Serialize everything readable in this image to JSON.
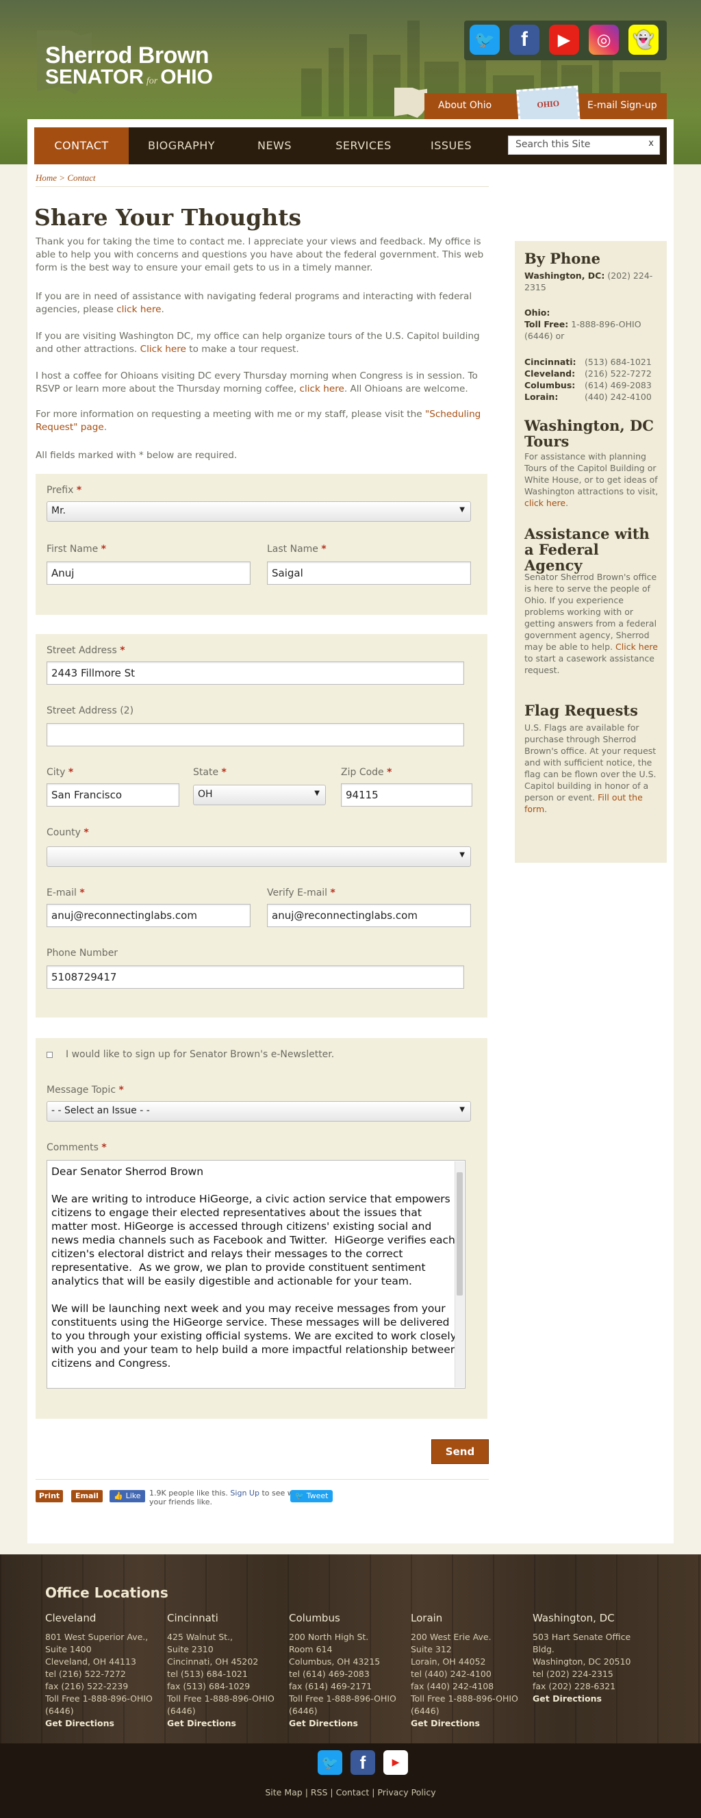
{
  "header": {
    "logo_line1": "Sherrod Brown",
    "logo_senator": "SENATOR",
    "logo_for": "for",
    "logo_ohio": "OHIO",
    "about_link": "About Ohio",
    "signup_link": "E-mail Sign-up",
    "stamp_text": "OHIO"
  },
  "social": {
    "icons": [
      "twitter-icon",
      "facebook-icon",
      "youtube-icon",
      "instagram-icon",
      "snapchat-icon"
    ]
  },
  "nav": {
    "items": [
      "CONTACT",
      "BIOGRAPHY",
      "NEWS",
      "SERVICES",
      "ISSUES"
    ],
    "search_placeholder": "Search this Site",
    "search_clear": "x"
  },
  "breadcrumb": {
    "home": "Home",
    "sep": " > ",
    "current": "Contact"
  },
  "main": {
    "title": "Share Your Thoughts",
    "p1": "Thank you for taking the time to contact me.  I appreciate your views and feedback. My office is able to help you with concerns and questions you have about the federal government. This web form is the best way to ensure your email gets to us in a timely manner.",
    "p2_text": "If you are in need of assistance with navigating federal programs and interacting with federal agencies, please ",
    "p2_link": "click here",
    "p2_end": ".",
    "p3_text": "If you are visiting Washington DC, my office can help organize tours of the U.S. Capitol building and other attractions. ",
    "p3_link": "Click here",
    "p3_end": " to make a tour request.",
    "p4_text": "I host a coffee for Ohioans visiting DC every Thursday morning when Congress is in session. To RSVP or learn more about the Thursday morning coffee, ",
    "p4_link": "click here",
    "p4_end": ". All Ohioans are welcome.",
    "p5_text": "For more information on requesting a meeting with me or my staff, please visit the ",
    "p5_link": "\"Scheduling Request\" page",
    "p5_end": ".",
    "required_note": "All fields marked with * below are required."
  },
  "form": {
    "prefix_label": "Prefix",
    "prefix_value": "Mr.",
    "first_name_label": "First Name",
    "first_name_value": "Anuj",
    "last_name_label": "Last Name",
    "last_name_value": "Saigal",
    "street_label": "Street Address",
    "street_value": "2443 Fillmore St",
    "street2_label": "Street Address (2)",
    "street2_value": "",
    "city_label": "City",
    "city_value": "San Francisco",
    "state_label": "State",
    "state_value": "OH",
    "zip_label": "Zip Code",
    "zip_value": "94115",
    "county_label": "County",
    "county_value": "",
    "email_label": "E-mail",
    "email_value": "anuj@reconnectinglabs.com",
    "verify_email_label": "Verify E-mail",
    "verify_email_value": "anuj@reconnectinglabs.com",
    "phone_label": "Phone Number",
    "phone_value": "5108729417",
    "newsletter_label": "I would like to sign up for Senator Brown's e-Newsletter.",
    "topic_label": "Message Topic",
    "topic_value": "- - Select an Issue - -",
    "comments_label": "Comments",
    "required_mark": "*",
    "comments_value": "Dear Senator Sherrod Brown\n\nWe are writing to introduce HiGeorge, a civic action service that empowers citizens to engage their elected representatives about the issues that matter most. HiGeorge is accessed through citizens' existing social and news media channels such as Facebook and Twitter.  HiGeorge verifies each citizen's electoral district and relays their messages to the correct representative.  As we grow, we plan to provide constituent sentiment analytics that will be easily digestible and actionable for your team.\n\nWe will be launching next week and you may receive messages from your constituents using the HiGeorge service. These messages will be delivered to you through your existing official systems. We are excited to work closely with you and your team to help build a more impactful relationship between citizens and Congress.",
    "send_label": "Send"
  },
  "share": {
    "print": "Print",
    "email": "Email",
    "like": "Like",
    "like_text": "1.9K people like this.",
    "signup": "Sign Up",
    "like_tail": "to see what your friends like.",
    "tweet": "Tweet"
  },
  "sidebar": {
    "phone_title": "By Phone",
    "dc_label": "Washington, DC:",
    "dc_phone": "(202) 224-2315",
    "ohio_label": "Ohio:",
    "tollfree_label": "Toll Free:",
    "tollfree_value": "1-888-896-OHIO (6446) or",
    "cities": [
      {
        "name": "Cincinnati:",
        "phone": "(513) 684-1021"
      },
      {
        "name": "Cleveland:",
        "phone": "(216) 522-7272"
      },
      {
        "name": "Columbus:",
        "phone": "(614) 469-2083"
      },
      {
        "name": "Lorain:",
        "phone": "(440) 242-4100"
      }
    ],
    "tours_title": "Washington, DC Tours",
    "tours_text": "For assistance with planning Tours of the Capitol Building or White House, or to get ideas of Washington attractions to visit, ",
    "tours_link": "click here",
    "agency_title": "Assistance with a Federal Agency",
    "agency_text": "Senator Sherrod Brown's office is here to serve the people of Ohio. If you experience problems working with or getting answers from a federal government agency, Sherrod may be able to help. ",
    "agency_link": "Click here",
    "agency_end": " to start a casework assistance request.",
    "flag_title": "Flag Requests",
    "flag_text": "U.S. Flags are available for purchase through Sherrod Brown's office. At your request and with sufficient notice, the flag can be flown over the U.S. Capitol building in honor of a person or event. ",
    "flag_link": "Fill out the form",
    "period": "."
  },
  "footer": {
    "title": "Office Locations",
    "offices": [
      {
        "city": "Cleveland",
        "l1": "801 West Superior Ave.,",
        "l2": "Suite 1400",
        "l3": "Cleveland, OH 44113",
        "tel": "tel (216) 522-7272",
        "fax": "fax (216) 522-2239",
        "toll": "Toll Free 1-888-896-OHIO (6446)",
        "dir": "Get Directions"
      },
      {
        "city": "Cincinnati",
        "l1": "425 Walnut St.,",
        "l2": "Suite 2310",
        "l3": "Cincinnati, OH 45202",
        "tel": "tel (513) 684-1021",
        "fax": "fax (513) 684-1029",
        "toll": "Toll Free 1-888-896-OHIO (6446)",
        "dir": "Get Directions"
      },
      {
        "city": "Columbus",
        "l1": "200 North High St.",
        "l2": "Room 614",
        "l3": "Columbus, OH 43215",
        "tel": "tel (614) 469-2083",
        "fax": "fax (614) 469-2171",
        "toll": "Toll Free 1-888-896-OHIO (6446)",
        "dir": "Get Directions"
      },
      {
        "city": "Lorain",
        "l1": "200 West Erie Ave.",
        "l2": "Suite 312",
        "l3": "Lorain, OH 44052",
        "tel": "tel (440) 242-4100",
        "fax": "fax (440) 242-4108",
        "toll": "Toll Free 1-888-896-OHIO (6446)",
        "dir": "Get Directions"
      },
      {
        "city": "Washington, DC",
        "l1": "503 Hart Senate Office",
        "l2": "Bldg.",
        "l3": "Washington, DC 20510",
        "tel": "tel (202) 224-2315",
        "fax": "fax (202) 228-6321",
        "toll": "",
        "dir": "Get Directions"
      }
    ],
    "links": [
      "Site Map",
      "RSS",
      "Contact",
      "Privacy Policy"
    ],
    "sep": " | "
  },
  "colors": {
    "accent": "#a54e12",
    "header_green": "#6f8a3a",
    "footer_brown": "#3b2f22",
    "panel": "#f3efdd"
  }
}
